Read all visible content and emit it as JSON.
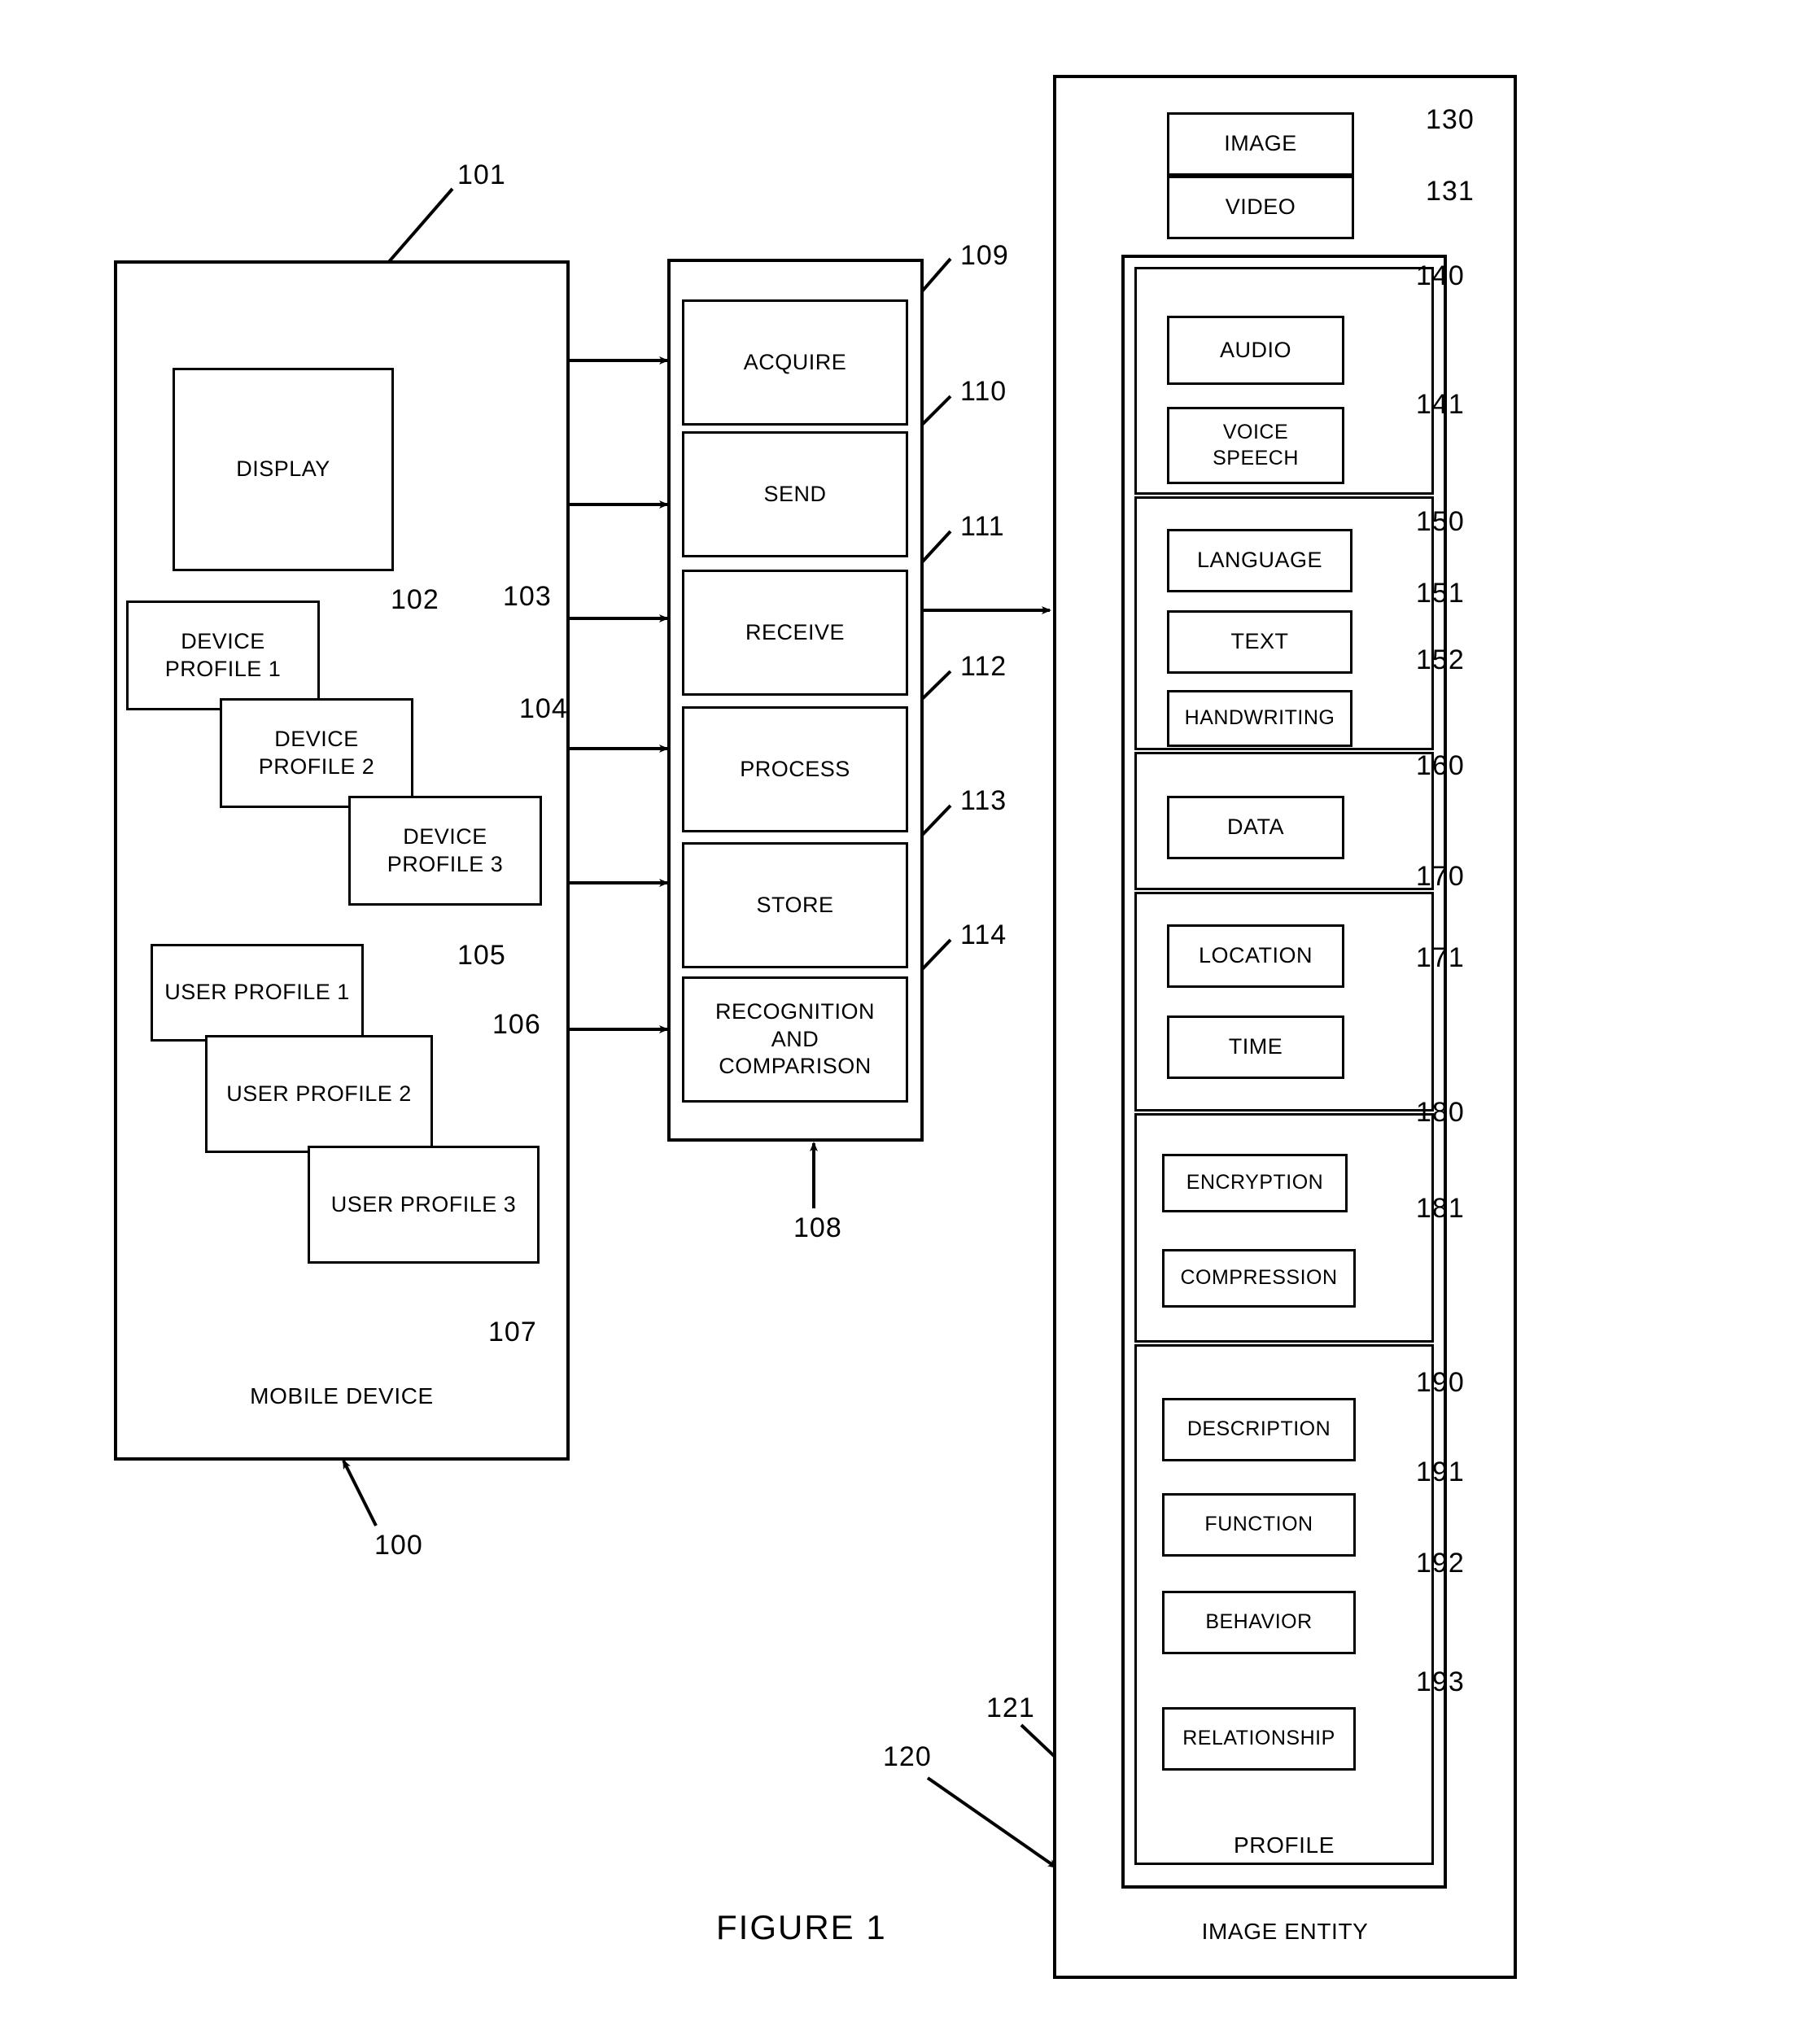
{
  "figure": {
    "label": "FIGURE 1"
  },
  "mobile_device": {
    "caption": "MOBILE DEVICE",
    "ref": "100",
    "display": {
      "label": "DISPLAY",
      "ref": "101"
    },
    "device_profiles": [
      {
        "label": "DEVICE\nPROFILE 1",
        "ref": "102"
      },
      {
        "label": "DEVICE\nPROFILE 2",
        "ref": "103"
      },
      {
        "label": "DEVICE\nPROFILE 3",
        "ref": "104"
      }
    ],
    "user_profiles": [
      {
        "label": "USER PROFILE 1",
        "ref": "105"
      },
      {
        "label": "USER PROFILE 2",
        "ref": "106"
      },
      {
        "label": "USER PROFILE 3",
        "ref": "107"
      }
    ]
  },
  "process_column": {
    "ref": "108",
    "items": [
      {
        "label": "ACQUIRE",
        "ref": "109"
      },
      {
        "label": "SEND",
        "ref": "110"
      },
      {
        "label": "RECEIVE",
        "ref": "111"
      },
      {
        "label": "PROCESS",
        "ref": "112"
      },
      {
        "label": "STORE",
        "ref": "113"
      },
      {
        "label": "RECOGNITION\nAND\nCOMPARISON",
        "ref": "114"
      }
    ]
  },
  "image_entity": {
    "caption": "IMAGE ENTITY",
    "ref": "120",
    "profile": {
      "caption": "PROFILE",
      "ref": "121"
    },
    "media": [
      {
        "label": "IMAGE",
        "ref": "130"
      },
      {
        "label": "VIDEO",
        "ref": "131"
      }
    ],
    "groups": [
      {
        "name": "audio-group",
        "items": [
          {
            "label": "AUDIO",
            "ref": "140"
          },
          {
            "label": "VOICE\nSPEECH",
            "ref": "141"
          }
        ]
      },
      {
        "name": "language-group",
        "items": [
          {
            "label": "LANGUAGE",
            "ref": "150"
          },
          {
            "label": "TEXT",
            "ref": "151"
          },
          {
            "label": "HANDWRITING",
            "ref": "152"
          }
        ]
      },
      {
        "name": "data-group",
        "items": [
          {
            "label": "DATA",
            "ref": "160"
          }
        ]
      },
      {
        "name": "context-group",
        "items": [
          {
            "label": "LOCATION",
            "ref": "170"
          },
          {
            "label": "TIME",
            "ref": "171"
          }
        ]
      },
      {
        "name": "security-group",
        "items": [
          {
            "label": "ENCRYPTION",
            "ref": "180"
          },
          {
            "label": "COMPRESSION",
            "ref": "181"
          }
        ]
      },
      {
        "name": "semantics-group",
        "items": [
          {
            "label": "DESCRIPTION",
            "ref": "190"
          },
          {
            "label": "FUNCTION",
            "ref": "191"
          },
          {
            "label": "BEHAVIOR",
            "ref": "192"
          },
          {
            "label": "RELATIONSHIP",
            "ref": "193"
          }
        ]
      }
    ]
  }
}
